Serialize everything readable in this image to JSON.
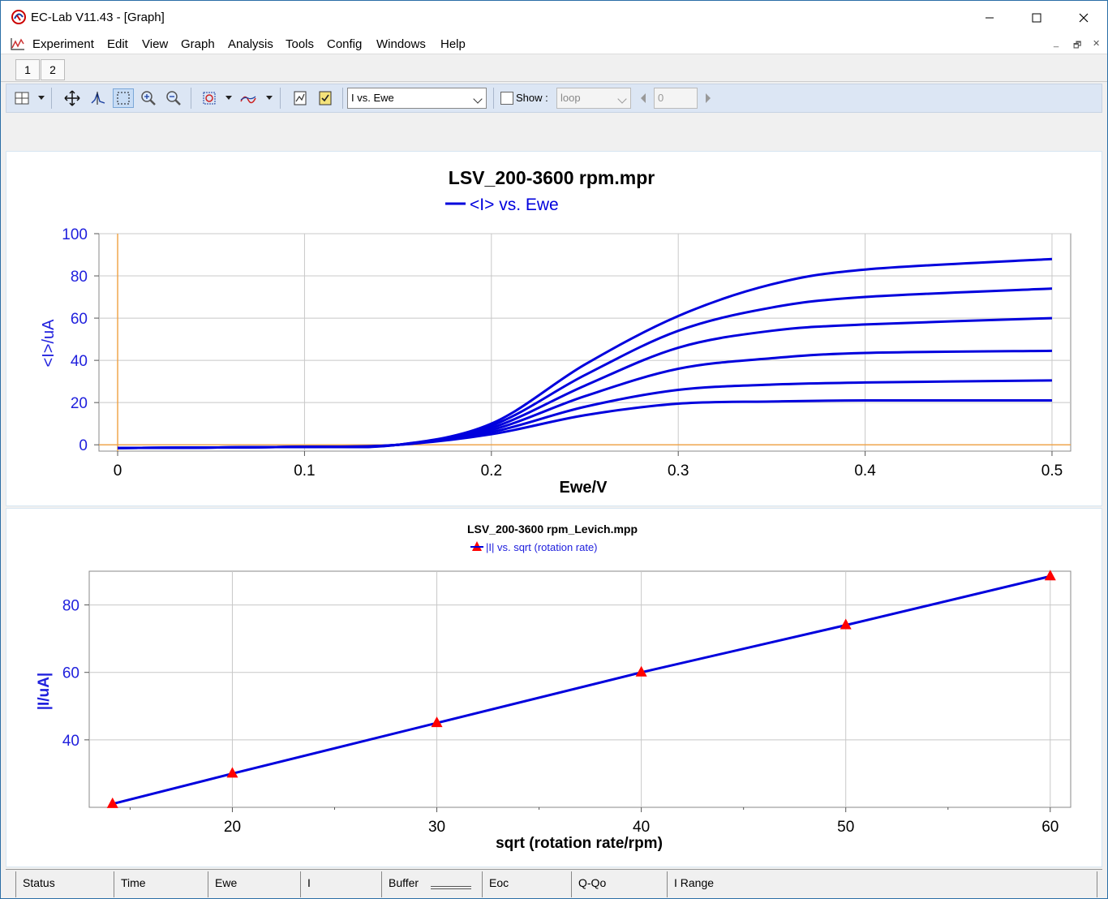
{
  "window": {
    "title": "EC-Lab V11.43 - [Graph]"
  },
  "menu": {
    "items": [
      "Experiment",
      "Edit",
      "View",
      "Graph",
      "Analysis",
      "Tools",
      "Config",
      "Windows",
      "Help"
    ],
    "mdi_controls": [
      "_",
      "🗗",
      "✕"
    ]
  },
  "tabs": [
    "1",
    "2"
  ],
  "toolbar": {
    "graph_select_value": "I vs. Ewe",
    "show_label": "Show :",
    "show_checked": false,
    "loop_value": "loop",
    "loop_index": "0"
  },
  "status_bar": {
    "fields": [
      "Status",
      "Time",
      "Ewe",
      "I",
      "Buffer",
      "Eoc",
      "Q-Qo",
      "I Range"
    ]
  },
  "chart_data": [
    {
      "type": "line",
      "title": "LSV_200-3600 rpm.mpr",
      "legend": "<I> vs. Ewe",
      "xlabel": "Ewe/V",
      "ylabel": "<I>/uA",
      "xlim": [
        -0.01,
        0.51
      ],
      "ylim": [
        -3,
        100
      ],
      "xticks": [
        "0",
        "0.1",
        "0.2",
        "0.3",
        "0.4",
        "0.5"
      ],
      "yticks": [
        "0",
        "20",
        "40",
        "60",
        "80",
        "100"
      ],
      "series_color": "#0000dd",
      "series": [
        {
          "limit": 21,
          "points": [
            [
              0,
              -1.5
            ],
            [
              0.1,
              -1
            ],
            [
              0.15,
              0
            ],
            [
              0.2,
              5
            ],
            [
              0.25,
              14
            ],
            [
              0.3,
              19.5
            ],
            [
              0.35,
              20.5
            ],
            [
              0.4,
              21
            ],
            [
              0.5,
              21
            ]
          ]
        },
        {
          "limit": 30,
          "points": [
            [
              0,
              -1.5
            ],
            [
              0.1,
              -1
            ],
            [
              0.15,
              0
            ],
            [
              0.2,
              6
            ],
            [
              0.25,
              18
            ],
            [
              0.3,
              26
            ],
            [
              0.35,
              28.5
            ],
            [
              0.4,
              29.5
            ],
            [
              0.5,
              30.5
            ]
          ]
        },
        {
          "limit": 45,
          "points": [
            [
              0,
              -1.5
            ],
            [
              0.1,
              -1
            ],
            [
              0.15,
              0
            ],
            [
              0.2,
              7
            ],
            [
              0.25,
              23
            ],
            [
              0.3,
              36
            ],
            [
              0.35,
              41
            ],
            [
              0.4,
              43.5
            ],
            [
              0.5,
              44.5
            ]
          ]
        },
        {
          "limit": 60,
          "points": [
            [
              0,
              -1.5
            ],
            [
              0.1,
              -1
            ],
            [
              0.15,
              0
            ],
            [
              0.2,
              8
            ],
            [
              0.25,
              28
            ],
            [
              0.3,
              46
            ],
            [
              0.35,
              54
            ],
            [
              0.4,
              57
            ],
            [
              0.5,
              60
            ]
          ]
        },
        {
          "limit": 74,
          "points": [
            [
              0,
              -1.5
            ],
            [
              0.1,
              -1
            ],
            [
              0.15,
              0
            ],
            [
              0.2,
              9
            ],
            [
              0.25,
              33
            ],
            [
              0.3,
              54
            ],
            [
              0.35,
              65
            ],
            [
              0.4,
              70
            ],
            [
              0.5,
              74
            ]
          ]
        },
        {
          "limit": 88,
          "points": [
            [
              0,
              -1.5
            ],
            [
              0.1,
              -1
            ],
            [
              0.15,
              0
            ],
            [
              0.2,
              10
            ],
            [
              0.25,
              38
            ],
            [
              0.3,
              61
            ],
            [
              0.35,
              76
            ],
            [
              0.4,
              83
            ],
            [
              0.5,
              88
            ]
          ]
        }
      ]
    },
    {
      "type": "scatter",
      "title": "LSV_200-3600 rpm_Levich.mpp",
      "legend": "|I| vs. sqrt (rotation rate)",
      "xlabel": "sqrt (rotation rate/rpm)",
      "ylabel": "|I/uA|",
      "xlim": [
        13,
        61
      ],
      "ylim": [
        20,
        90
      ],
      "xticks": [
        "20",
        "30",
        "40",
        "50",
        "60"
      ],
      "yticks": [
        "40",
        "60",
        "80"
      ],
      "line_color": "#0000dd",
      "marker_color": "#ff0000",
      "x": [
        14.14,
        20,
        30,
        40,
        50,
        60
      ],
      "y": [
        21,
        30,
        45,
        60,
        74,
        88.5
      ]
    }
  ]
}
